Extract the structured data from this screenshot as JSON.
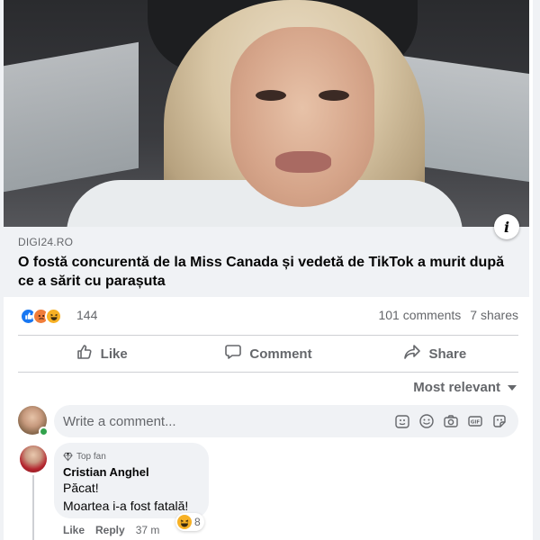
{
  "post": {
    "source": "DIGI24.RO",
    "headline": "O fostă concurentă de la Miss Canada și vedetă de TikTok a murit după ce a sărit cu parașuta",
    "info_label": "i"
  },
  "engagement": {
    "reaction_count": "144",
    "reactions": [
      "like",
      "angry",
      "haha"
    ],
    "comments": "101 comments",
    "shares": "7 shares"
  },
  "actions": {
    "like": "Like",
    "comment": "Comment",
    "share": "Share"
  },
  "sort": {
    "label": "Most relevant"
  },
  "composer": {
    "placeholder": "Write a comment..."
  },
  "comments": [
    {
      "badge": "Top fan",
      "author": "Cristian Anghel",
      "lines": [
        "Păcat!",
        "Moartea i-a fost fatală!"
      ],
      "reaction_count": "8",
      "like": "Like",
      "reply": "Reply",
      "time": "37 m"
    }
  ],
  "colors": {
    "like_blue": "#1877f2",
    "online_green": "#31a24c",
    "muted_text": "#65676b"
  }
}
